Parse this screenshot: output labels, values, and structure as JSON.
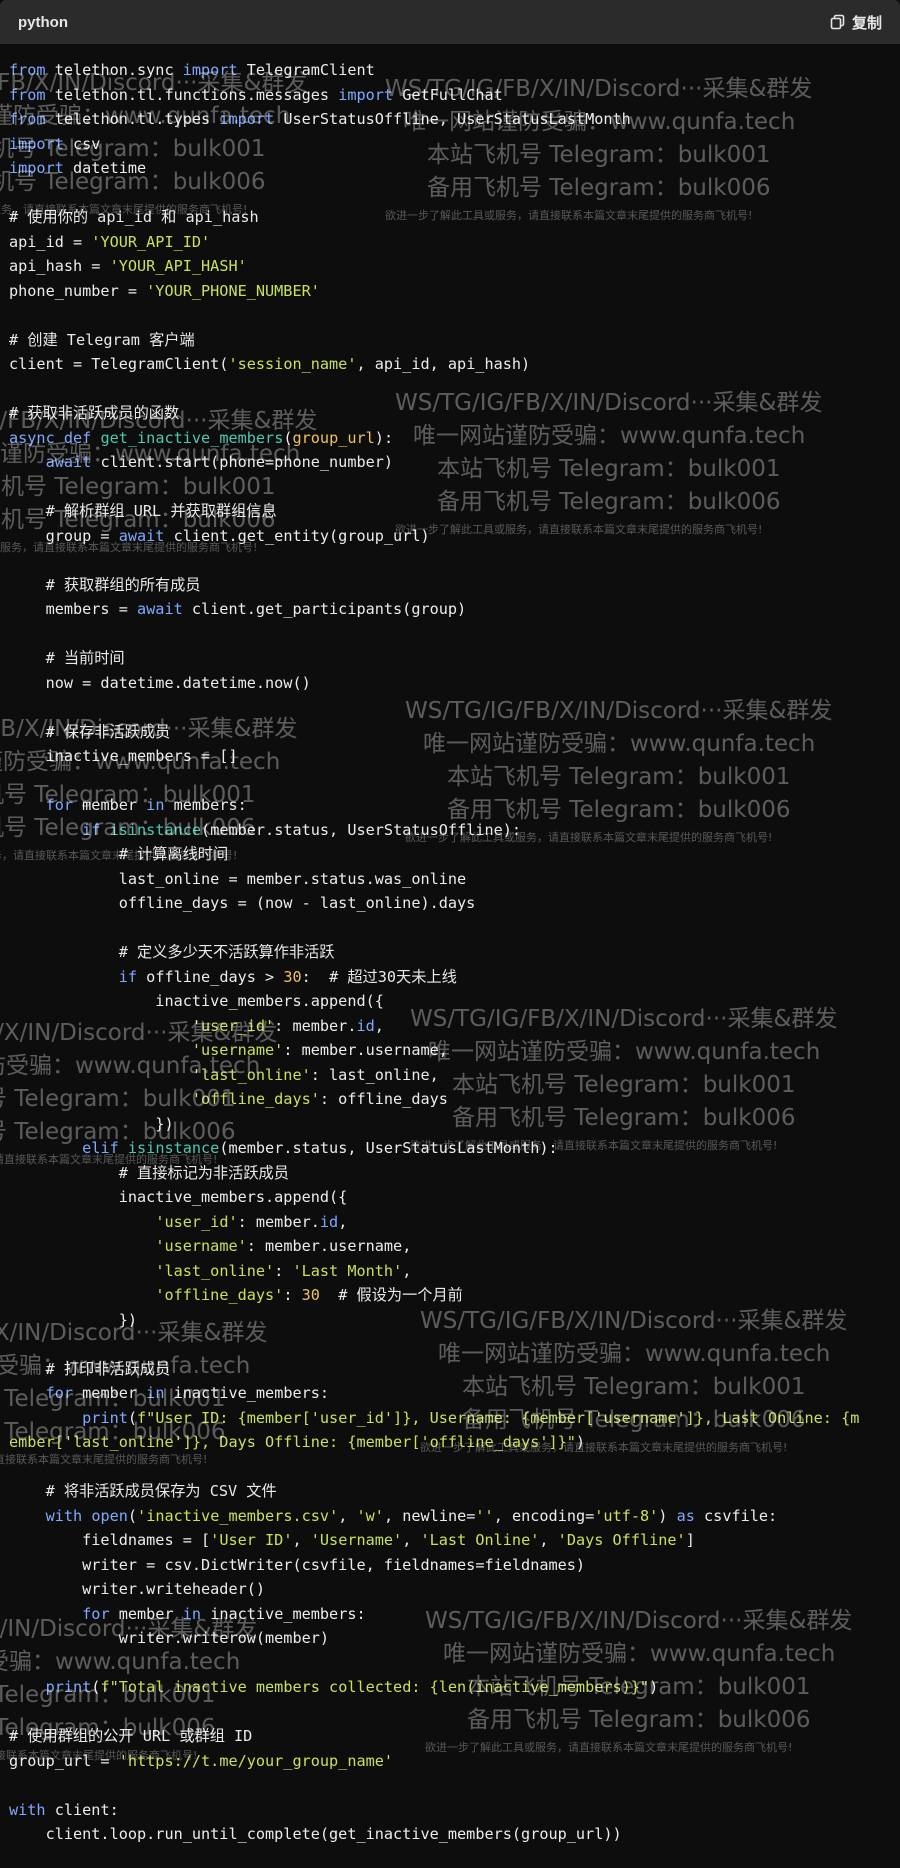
{
  "header": {
    "language": "python",
    "copy_label": "复制",
    "copy_icon": "copy-icon"
  },
  "watermark": {
    "line1": "WS/TG/IG/FB/X/IN/Discord···采集&群发",
    "line2": "唯一网站谨防受骗：www.qunfa.tech",
    "line3": "本站飞机号 Telegram：bulk001",
    "line4": "备用飞机号 Telegram：bulk006",
    "line5": "欲进一步了解此工具或服务，请直接联系本篇文章末尾提供的服务商飞机号!"
  },
  "code": {
    "lines": [
      [
        {
          "c": "kw",
          "t": "from"
        },
        {
          "t": " telethon.sync "
        },
        {
          "c": "kw",
          "t": "import"
        },
        {
          "t": " TelegramClient"
        }
      ],
      [
        {
          "c": "kw",
          "t": "from"
        },
        {
          "t": " telethon.tl.functions.messages "
        },
        {
          "c": "kw",
          "t": "import"
        },
        {
          "t": " GetFullChat"
        }
      ],
      [
        {
          "c": "kw",
          "t": "from"
        },
        {
          "t": " telethon.tl.types "
        },
        {
          "c": "kw",
          "t": "import"
        },
        {
          "t": " UserStatusOffline, UserStatusLastMonth"
        }
      ],
      [
        {
          "c": "kw",
          "t": "import"
        },
        {
          "t": " csv"
        }
      ],
      [
        {
          "c": "kw",
          "t": "import"
        },
        {
          "t": " datetime"
        }
      ],
      [],
      [
        {
          "c": "cm",
          "t": "# 使用你的 api_id 和 api_hash"
        }
      ],
      [
        {
          "t": "api_id = "
        },
        {
          "c": "str",
          "t": "'YOUR_API_ID'"
        }
      ],
      [
        {
          "t": "api_hash = "
        },
        {
          "c": "str",
          "t": "'YOUR_API_HASH'"
        }
      ],
      [
        {
          "t": "phone_number = "
        },
        {
          "c": "str",
          "t": "'YOUR_PHONE_NUMBER'"
        }
      ],
      [],
      [
        {
          "c": "cm",
          "t": "# 创建 Telegram 客户端"
        }
      ],
      [
        {
          "t": "client = TelegramClient("
        },
        {
          "c": "str",
          "t": "'session_name'"
        },
        {
          "t": ", api_id, api_hash)"
        }
      ],
      [],
      [
        {
          "c": "cm",
          "t": "# 获取非活跃成员的函数"
        }
      ],
      [
        {
          "c": "kw",
          "t": "async"
        },
        {
          "t": " "
        },
        {
          "c": "kw",
          "t": "def"
        },
        {
          "t": " "
        },
        {
          "c": "fn",
          "t": "get_inactive_members"
        },
        {
          "t": "("
        },
        {
          "c": "num",
          "t": "group_url"
        },
        {
          "t": "):"
        }
      ],
      [
        {
          "t": "    "
        },
        {
          "c": "kw",
          "t": "await"
        },
        {
          "t": " client.start(phone=phone_number)"
        }
      ],
      [],
      [
        {
          "t": "    "
        },
        {
          "c": "cm",
          "t": "# 解析群组 URL 并获取群组信息"
        }
      ],
      [
        {
          "t": "    group = "
        },
        {
          "c": "kw",
          "t": "await"
        },
        {
          "t": " client.get_entity(group_url)"
        }
      ],
      [],
      [
        {
          "t": "    "
        },
        {
          "c": "cm",
          "t": "# 获取群组的所有成员"
        }
      ],
      [
        {
          "t": "    members = "
        },
        {
          "c": "kw",
          "t": "await"
        },
        {
          "t": " client.get_participants(group)"
        }
      ],
      [],
      [
        {
          "t": "    "
        },
        {
          "c": "cm",
          "t": "# 当前时间"
        }
      ],
      [
        {
          "t": "    now = datetime.datetime.now()"
        }
      ],
      [],
      [
        {
          "t": "    "
        },
        {
          "c": "cm",
          "t": "# 保存非活跃成员"
        }
      ],
      [
        {
          "t": "    inactive_members = []"
        }
      ],
      [],
      [
        {
          "t": "    "
        },
        {
          "c": "kw",
          "t": "for"
        },
        {
          "t": " member "
        },
        {
          "c": "kw",
          "t": "in"
        },
        {
          "t": " members:"
        }
      ],
      [
        {
          "t": "        "
        },
        {
          "c": "kw",
          "t": "if"
        },
        {
          "t": " "
        },
        {
          "c": "fn",
          "t": "isinstance"
        },
        {
          "t": "(member.status, UserStatusOffline):"
        }
      ],
      [
        {
          "t": "            "
        },
        {
          "c": "cm",
          "t": "# 计算离线时间"
        }
      ],
      [
        {
          "t": "            last_online = member.status.was_online"
        }
      ],
      [
        {
          "t": "            offline_days = (now - last_online).days"
        }
      ],
      [],
      [
        {
          "t": "            "
        },
        {
          "c": "cm",
          "t": "# 定义多少天不活跃算作非活跃"
        }
      ],
      [
        {
          "t": "            "
        },
        {
          "c": "kw",
          "t": "if"
        },
        {
          "t": " offline_days > "
        },
        {
          "c": "num",
          "t": "30"
        },
        {
          "t": ":  "
        },
        {
          "c": "cm",
          "t": "# 超过30天未上线"
        }
      ],
      [
        {
          "t": "                inactive_members.append({"
        }
      ],
      [
        {
          "t": "                    "
        },
        {
          "c": "str",
          "t": "'user_id'"
        },
        {
          "t": ": member."
        },
        {
          "c": "kw",
          "t": "id"
        },
        {
          "t": ","
        }
      ],
      [
        {
          "t": "                    "
        },
        {
          "c": "str",
          "t": "'username'"
        },
        {
          "t": ": member.username,"
        }
      ],
      [
        {
          "t": "                    "
        },
        {
          "c": "str",
          "t": "'last_online'"
        },
        {
          "t": ": last_online,"
        }
      ],
      [
        {
          "t": "                    "
        },
        {
          "c": "str",
          "t": "'offline_days'"
        },
        {
          "t": ": offline_days"
        }
      ],
      [
        {
          "t": "                })"
        }
      ],
      [
        {
          "t": "        "
        },
        {
          "c": "kw",
          "t": "elif"
        },
        {
          "t": " "
        },
        {
          "c": "fn",
          "t": "isinstance"
        },
        {
          "t": "(member.status, UserStatusLastMonth):"
        }
      ],
      [
        {
          "t": "            "
        },
        {
          "c": "cm",
          "t": "# 直接标记为非活跃成员"
        }
      ],
      [
        {
          "t": "            inactive_members.append({"
        }
      ],
      [
        {
          "t": "                "
        },
        {
          "c": "str",
          "t": "'user_id'"
        },
        {
          "t": ": member."
        },
        {
          "c": "kw",
          "t": "id"
        },
        {
          "t": ","
        }
      ],
      [
        {
          "t": "                "
        },
        {
          "c": "str",
          "t": "'username'"
        },
        {
          "t": ": member.username,"
        }
      ],
      [
        {
          "t": "                "
        },
        {
          "c": "str",
          "t": "'last_online'"
        },
        {
          "t": ": "
        },
        {
          "c": "str",
          "t": "'Last Month'"
        },
        {
          "t": ","
        }
      ],
      [
        {
          "t": "                "
        },
        {
          "c": "str",
          "t": "'offline_days'"
        },
        {
          "t": ": "
        },
        {
          "c": "num",
          "t": "30"
        },
        {
          "t": "  "
        },
        {
          "c": "cm",
          "t": "# 假设为一个月前"
        }
      ],
      [
        {
          "t": "            })"
        }
      ],
      [],
      [
        {
          "t": "    "
        },
        {
          "c": "cm",
          "t": "# 打印非活跃成员"
        }
      ],
      [
        {
          "t": "    "
        },
        {
          "c": "kw",
          "t": "for"
        },
        {
          "t": " member "
        },
        {
          "c": "kw",
          "t": "in"
        },
        {
          "t": " inactive_members:"
        }
      ],
      [
        {
          "t": "        "
        },
        {
          "c": "kw",
          "t": "print"
        },
        {
          "t": "("
        },
        {
          "c": "str",
          "t": "f\"User ID: {member['user_id']}, Username: {member['username']}, Last Online: {m"
        }
      ],
      [
        {
          "c": "str",
          "t": "ember['last_online']}, Days Offline: {member['offline_days']}\""
        },
        {
          "t": ")"
        }
      ],
      [],
      [
        {
          "t": "    "
        },
        {
          "c": "cm",
          "t": "# 将非活跃成员保存为 CSV 文件"
        }
      ],
      [
        {
          "t": "    "
        },
        {
          "c": "kw",
          "t": "with"
        },
        {
          "t": " "
        },
        {
          "c": "kw",
          "t": "open"
        },
        {
          "t": "("
        },
        {
          "c": "str",
          "t": "'inactive_members.csv'"
        },
        {
          "t": ", "
        },
        {
          "c": "str",
          "t": "'w'"
        },
        {
          "t": ", newline="
        },
        {
          "c": "str",
          "t": "''"
        },
        {
          "t": ", encoding="
        },
        {
          "c": "str",
          "t": "'utf-8'"
        },
        {
          "t": ") "
        },
        {
          "c": "kw",
          "t": "as"
        },
        {
          "t": " csvfile:"
        }
      ],
      [
        {
          "t": "        fieldnames = ["
        },
        {
          "c": "str",
          "t": "'User ID'"
        },
        {
          "t": ", "
        },
        {
          "c": "str",
          "t": "'Username'"
        },
        {
          "t": ", "
        },
        {
          "c": "str",
          "t": "'Last Online'"
        },
        {
          "t": ", "
        },
        {
          "c": "str",
          "t": "'Days Offline'"
        },
        {
          "t": "]"
        }
      ],
      [
        {
          "t": "        writer = csv.DictWriter(csvfile, fieldnames=fieldnames)"
        }
      ],
      [
        {
          "t": "        writer.writeheader()"
        }
      ],
      [
        {
          "t": "        "
        },
        {
          "c": "kw",
          "t": "for"
        },
        {
          "t": " member "
        },
        {
          "c": "kw",
          "t": "in"
        },
        {
          "t": " inactive_members:"
        }
      ],
      [
        {
          "t": "            writer.writerow(member)"
        }
      ],
      [],
      [
        {
          "t": "    "
        },
        {
          "c": "kw",
          "t": "print"
        },
        {
          "t": "("
        },
        {
          "c": "str",
          "t": "f\"Total inactive members collected: {len(inactive_members)}\""
        },
        {
          "t": ")"
        }
      ],
      [],
      [
        {
          "c": "cm",
          "t": "# 使用群组的公开 URL 或群组 ID"
        }
      ],
      [
        {
          "t": "group_url = "
        },
        {
          "c": "str",
          "t": "'https://t.me/your_group_name'"
        }
      ],
      [],
      [
        {
          "c": "kw",
          "t": "with"
        },
        {
          "t": " client:"
        }
      ],
      [
        {
          "t": "    client.loop.run_until_complete(get_inactive_members(group_url))"
        }
      ]
    ]
  }
}
